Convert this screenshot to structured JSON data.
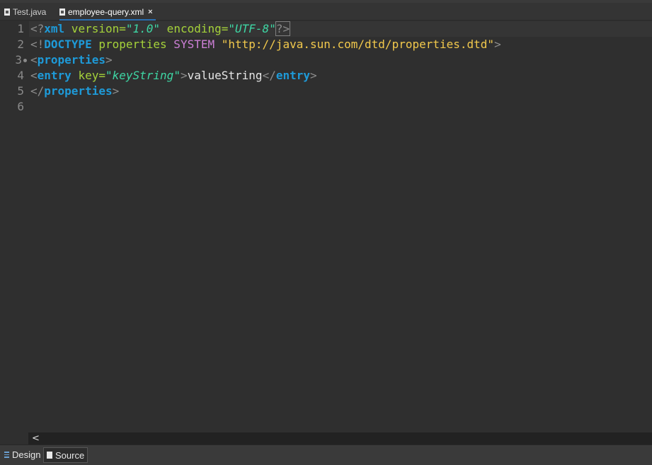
{
  "tabs": [
    {
      "label": "Test.java",
      "active": false
    },
    {
      "label": "employee-query.xml",
      "active": true,
      "close": "×"
    }
  ],
  "line_numbers": [
    "1",
    "2",
    "3",
    "4",
    "5",
    "6"
  ],
  "code": {
    "line1": {
      "open": "<?",
      "name": "xml",
      "attr1": " version",
      "eq1": "=",
      "val1": "\"1.0\"",
      "attr2": " encoding",
      "eq2": "=",
      "val2": "\"UTF-8\"",
      "close": "?>"
    },
    "line2": {
      "open": "<!",
      "keyword": "DOCTYPE",
      "root": " properties",
      "system": " SYSTEM",
      "url": " \"http://java.sun.com/dtd/properties.dtd\"",
      "close": ">"
    },
    "line3": {
      "open": "<",
      "tag": "properties",
      "close": ">"
    },
    "line4": {
      "open": "<",
      "tag": "entry",
      "attr": " key",
      "eq": "=",
      "val": "\"keyString\"",
      "close": ">",
      "text": "valueString",
      "endopen": "</",
      "endtag": "entry",
      "endclose": ">"
    },
    "line5": {
      "open": "</",
      "tag": "properties",
      "close": ">"
    }
  },
  "scroll_left_arrow": "<",
  "bottom_tabs": [
    {
      "label": "Design",
      "active": false
    },
    {
      "label": "Source",
      "active": true
    }
  ],
  "colors": {
    "background": "#2f2f2f",
    "tag": "#1e9ad8",
    "attribute": "#a5d23a",
    "value": "#3ed6a4",
    "string": "#f2c94c",
    "doctype": "#cc7fd6"
  }
}
